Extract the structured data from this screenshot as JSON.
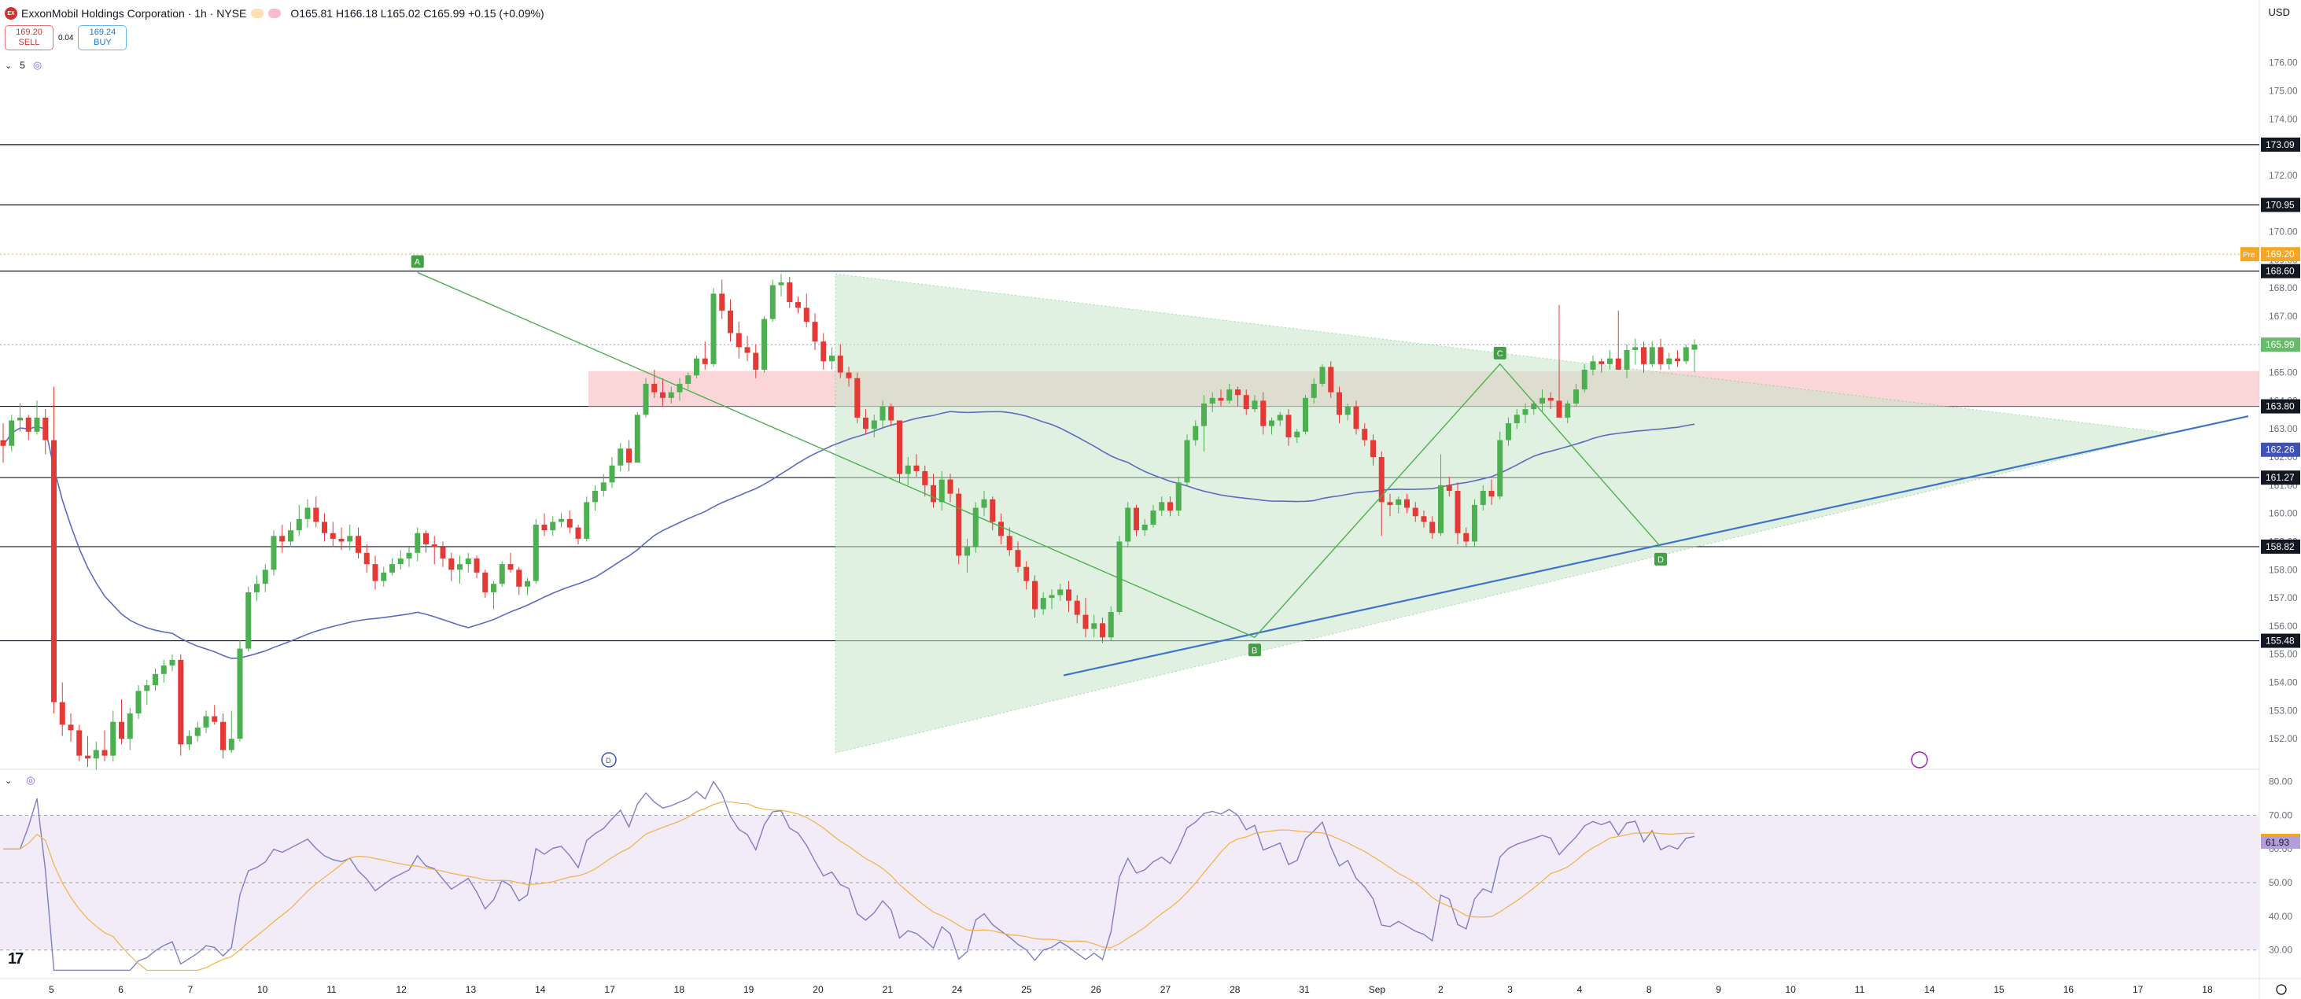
{
  "header": {
    "logo_text": "EX",
    "title": "ExxonMobil Holdings Corporation · 1h · NYSE",
    "ohlc": "O165.81 H166.18 L165.02 C165.99 +0.15 (+0.09%)"
  },
  "trade": {
    "sell_price": "169.20",
    "sell_label": "SELL",
    "spread": "0.04",
    "buy_price": "169.24",
    "buy_label": "BUY"
  },
  "indicator": {
    "count_label": "5",
    "chevron": "⌄"
  },
  "currency": "USD",
  "pre_label": "Pre",
  "tv_logo": "17",
  "colors": {
    "up": "#4caf50",
    "down": "#e53935",
    "ma": "#5c6bc0",
    "trend": "#3f74c9",
    "zone": "#f8c8cc",
    "triangle": "#c8e6c9",
    "rsi": "#7e7ec7",
    "rsi_ma": "#f5b041",
    "rsi_band": "#ede7f6"
  },
  "chart_data": {
    "type": "candlestick",
    "price_axis": {
      "range": [
        151.0,
        178.0
      ],
      "ticks": [
        "176.00",
        "175.00",
        "174.00",
        "173.00",
        "172.00",
        "171.00",
        "170.00",
        "169.00",
        "168.00",
        "167.00",
        "166.00",
        "165.00",
        "164.00",
        "163.00",
        "162.00",
        "161.00",
        "160.00",
        "159.00",
        "158.00",
        "157.00",
        "156.00",
        "155.00",
        "154.00",
        "153.00",
        "152.00"
      ],
      "labels": [
        {
          "value": 173.09,
          "text": "173.09",
          "style": "black"
        },
        {
          "value": 170.95,
          "text": "170.95",
          "style": "black"
        },
        {
          "value": 169.2,
          "text": "169.20",
          "style": "orange"
        },
        {
          "value": 168.6,
          "text": "168.60",
          "style": "black"
        },
        {
          "value": 165.99,
          "text": "165.99",
          "style": "green"
        },
        {
          "value": 163.8,
          "text": "163.80",
          "style": "black"
        },
        {
          "value": 162.26,
          "text": "162.26",
          "style": "blue"
        },
        {
          "value": 161.27,
          "text": "161.27",
          "style": "black"
        },
        {
          "value": 158.82,
          "text": "158.82",
          "style": "black"
        },
        {
          "value": 155.48,
          "text": "155.48",
          "style": "black"
        }
      ]
    },
    "horizontal_levels": [
      173.09,
      170.95,
      168.6,
      163.8,
      161.27,
      158.82,
      155.48
    ],
    "x_axis_labels": [
      "5",
      "6",
      "7",
      "10",
      "11",
      "12",
      "13",
      "14",
      "17",
      "18",
      "19",
      "20",
      "21",
      "24",
      "25",
      "26",
      "27",
      "28",
      "31",
      "Sep",
      "2",
      "3",
      "4",
      "8",
      "9",
      "10",
      "11",
      "14",
      "15",
      "16",
      "17",
      "18"
    ],
    "pattern_points": [
      {
        "label": "A",
        "bar": 49,
        "price": 168.55
      },
      {
        "label": "B",
        "bar": 148,
        "price": 155.6
      },
      {
        "label": "C",
        "bar": 177,
        "price": 165.3
      },
      {
        "label": "D",
        "bar": 196,
        "price": 158.82
      }
    ],
    "resistance_zone": [
      163.8,
      165.05
    ],
    "candles": [
      [
        162.6,
        163.2,
        161.8,
        162.4
      ],
      [
        162.4,
        163.5,
        162.2,
        163.3
      ],
      [
        163.3,
        163.9,
        162.9,
        163.4
      ],
      [
        163.4,
        163.5,
        162.6,
        162.9
      ],
      [
        162.9,
        164.0,
        162.8,
        163.4
      ],
      [
        163.4,
        163.7,
        162.1,
        162.6
      ],
      [
        162.6,
        164.5,
        152.9,
        153.3
      ],
      [
        153.3,
        154.0,
        152.1,
        152.5
      ],
      [
        152.5,
        152.9,
        151.9,
        152.3
      ],
      [
        152.3,
        152.5,
        151.2,
        151.4
      ],
      [
        151.4,
        152.1,
        151.0,
        151.3
      ],
      [
        151.3,
        151.9,
        150.9,
        151.6
      ],
      [
        151.6,
        152.3,
        151.2,
        151.4
      ],
      [
        151.4,
        153.0,
        151.2,
        152.6
      ],
      [
        152.6,
        153.4,
        151.8,
        152.0
      ],
      [
        152.0,
        153.1,
        151.6,
        152.9
      ],
      [
        152.9,
        153.9,
        152.7,
        153.7
      ],
      [
        153.7,
        154.1,
        153.2,
        153.9
      ],
      [
        153.9,
        154.5,
        153.7,
        154.3
      ],
      [
        154.3,
        154.8,
        154.0,
        154.6
      ],
      [
        154.6,
        155.0,
        154.4,
        154.8
      ],
      [
        154.8,
        155.0,
        151.4,
        151.8
      ],
      [
        151.8,
        152.3,
        151.6,
        152.1
      ],
      [
        152.1,
        152.6,
        151.9,
        152.4
      ],
      [
        152.4,
        153.0,
        152.2,
        152.8
      ],
      [
        152.8,
        153.2,
        152.5,
        152.6
      ],
      [
        152.6,
        152.9,
        151.3,
        151.6
      ],
      [
        151.6,
        153.0,
        151.5,
        152.0
      ],
      [
        152.0,
        155.5,
        151.9,
        155.2
      ],
      [
        155.2,
        157.4,
        155.1,
        157.2
      ],
      [
        157.2,
        157.8,
        156.9,
        157.5
      ],
      [
        157.5,
        158.2,
        157.2,
        158.0
      ],
      [
        158.0,
        159.4,
        157.8,
        159.2
      ],
      [
        159.2,
        159.6,
        158.6,
        159.0
      ],
      [
        159.0,
        159.7,
        158.8,
        159.4
      ],
      [
        159.4,
        160.3,
        159.2,
        159.8
      ],
      [
        159.8,
        160.5,
        159.5,
        160.2
      ],
      [
        160.2,
        160.6,
        159.5,
        159.7
      ],
      [
        159.7,
        160.0,
        159.0,
        159.3
      ],
      [
        159.3,
        159.7,
        158.8,
        159.1
      ],
      [
        159.1,
        159.5,
        158.7,
        159.0
      ],
      [
        159.0,
        159.6,
        158.7,
        159.2
      ],
      [
        159.2,
        159.5,
        158.4,
        158.6
      ],
      [
        158.6,
        158.9,
        157.9,
        158.2
      ],
      [
        158.2,
        158.5,
        157.3,
        157.6
      ],
      [
        157.6,
        158.1,
        157.4,
        157.9
      ],
      [
        157.9,
        158.4,
        157.8,
        158.2
      ],
      [
        158.2,
        158.7,
        158.0,
        158.4
      ],
      [
        158.4,
        158.8,
        158.1,
        158.6
      ],
      [
        158.6,
        159.5,
        158.3,
        159.3
      ],
      [
        159.3,
        159.4,
        158.6,
        158.9
      ],
      [
        158.9,
        159.2,
        158.2,
        158.8
      ],
      [
        158.8,
        159.0,
        158.1,
        158.4
      ],
      [
        158.4,
        158.6,
        157.6,
        158.0
      ],
      [
        158.0,
        158.5,
        157.5,
        158.2
      ],
      [
        158.2,
        158.6,
        157.9,
        158.4
      ],
      [
        158.4,
        158.5,
        157.7,
        157.9
      ],
      [
        157.9,
        158.0,
        157.0,
        157.2
      ],
      [
        157.2,
        157.6,
        156.6,
        157.5
      ],
      [
        157.5,
        158.3,
        157.4,
        158.2
      ],
      [
        158.2,
        158.6,
        157.9,
        158.0
      ],
      [
        158.0,
        158.1,
        157.1,
        157.4
      ],
      [
        157.4,
        157.7,
        157.1,
        157.6
      ],
      [
        157.6,
        159.8,
        157.5,
        159.6
      ],
      [
        159.6,
        160.0,
        159.2,
        159.4
      ],
      [
        159.4,
        159.9,
        159.2,
        159.7
      ],
      [
        159.7,
        160.0,
        159.5,
        159.8
      ],
      [
        159.8,
        160.1,
        159.3,
        159.5
      ],
      [
        159.5,
        159.6,
        158.9,
        159.1
      ],
      [
        159.1,
        160.6,
        159.0,
        160.4
      ],
      [
        160.4,
        161.0,
        160.1,
        160.8
      ],
      [
        160.8,
        161.4,
        160.6,
        161.1
      ],
      [
        161.1,
        162.0,
        160.9,
        161.7
      ],
      [
        161.7,
        162.5,
        161.5,
        162.3
      ],
      [
        162.3,
        162.6,
        161.5,
        161.8
      ],
      [
        161.8,
        163.6,
        163.2,
        163.5
      ],
      [
        163.5,
        164.8,
        163.4,
        164.6
      ],
      [
        164.6,
        165.1,
        164.1,
        164.3
      ],
      [
        164.3,
        164.8,
        163.8,
        164.1
      ],
      [
        164.1,
        164.5,
        163.9,
        164.3
      ],
      [
        164.3,
        164.8,
        164.0,
        164.6
      ],
      [
        164.6,
        165.0,
        164.4,
        164.9
      ],
      [
        164.9,
        165.6,
        164.8,
        165.5
      ],
      [
        165.5,
        166.1,
        165.1,
        165.3
      ],
      [
        165.3,
        168.0,
        165.2,
        167.8
      ],
      [
        167.8,
        168.3,
        166.9,
        167.2
      ],
      [
        167.2,
        167.6,
        166.1,
        166.4
      ],
      [
        166.4,
        166.8,
        165.5,
        165.9
      ],
      [
        165.9,
        166.3,
        165.4,
        165.7
      ],
      [
        165.7,
        166.0,
        164.8,
        165.1
      ],
      [
        165.1,
        167.0,
        165.0,
        166.9
      ],
      [
        166.9,
        168.3,
        166.8,
        168.1
      ],
      [
        168.1,
        168.5,
        167.7,
        168.2
      ],
      [
        168.2,
        168.4,
        167.3,
        167.5
      ],
      [
        167.5,
        167.7,
        167.1,
        167.3
      ],
      [
        167.3,
        167.8,
        166.6,
        166.8
      ],
      [
        166.8,
        167.1,
        165.8,
        166.1
      ],
      [
        166.1,
        166.4,
        165.1,
        165.4
      ],
      [
        165.4,
        165.9,
        165.1,
        165.6
      ],
      [
        165.6,
        166.0,
        164.8,
        165.0
      ],
      [
        165.0,
        165.2,
        164.5,
        164.8
      ],
      [
        164.8,
        165.0,
        163.2,
        163.4
      ],
      [
        163.4,
        163.7,
        162.8,
        163.0
      ],
      [
        163.0,
        163.5,
        162.7,
        163.3
      ],
      [
        163.3,
        164.0,
        163.0,
        163.8
      ],
      [
        163.8,
        163.9,
        163.1,
        163.3
      ],
      [
        163.3,
        162.6,
        161.1,
        161.4
      ],
      [
        161.4,
        162.0,
        161.0,
        161.7
      ],
      [
        161.7,
        162.1,
        161.3,
        161.5
      ],
      [
        161.5,
        161.7,
        160.6,
        161.0
      ],
      [
        161.0,
        161.4,
        160.2,
        160.4
      ],
      [
        160.4,
        161.5,
        160.1,
        161.2
      ],
      [
        161.2,
        161.4,
        160.4,
        160.7
      ],
      [
        160.7,
        160.9,
        158.2,
        158.5
      ],
      [
        158.5,
        159.1,
        157.9,
        158.8
      ],
      [
        158.8,
        160.4,
        158.6,
        160.2
      ],
      [
        160.2,
        160.8,
        159.9,
        160.5
      ],
      [
        160.5,
        160.6,
        159.4,
        159.7
      ],
      [
        159.7,
        160.0,
        158.9,
        159.2
      ],
      [
        159.2,
        159.5,
        158.5,
        158.7
      ],
      [
        158.7,
        159.0,
        157.9,
        158.1
      ],
      [
        158.1,
        158.3,
        157.3,
        157.6
      ],
      [
        157.6,
        157.8,
        156.3,
        156.6
      ],
      [
        156.6,
        157.2,
        156.4,
        157.0
      ],
      [
        157.0,
        157.3,
        156.6,
        157.1
      ],
      [
        157.1,
        157.5,
        156.9,
        157.3
      ],
      [
        157.3,
        157.6,
        156.5,
        156.9
      ],
      [
        156.9,
        157.1,
        156.1,
        156.4
      ],
      [
        156.4,
        157.0,
        155.6,
        155.9
      ],
      [
        155.9,
        156.4,
        155.6,
        156.1
      ],
      [
        156.1,
        156.3,
        155.4,
        155.6
      ],
      [
        155.6,
        156.7,
        155.5,
        156.5
      ],
      [
        156.5,
        159.2,
        156.4,
        159.0
      ],
      [
        159.0,
        160.4,
        158.8,
        160.2
      ],
      [
        160.2,
        160.3,
        159.2,
        159.4
      ],
      [
        159.4,
        159.8,
        159.2,
        159.6
      ],
      [
        159.6,
        160.3,
        159.5,
        160.1
      ],
      [
        160.1,
        160.6,
        159.9,
        160.4
      ],
      [
        160.4,
        160.6,
        159.9,
        160.1
      ],
      [
        160.1,
        161.3,
        159.9,
        161.1
      ],
      [
        161.1,
        162.8,
        161.0,
        162.6
      ],
      [
        162.6,
        163.3,
        162.4,
        163.1
      ],
      [
        163.1,
        164.2,
        162.2,
        163.9
      ],
      [
        163.9,
        164.3,
        163.6,
        164.1
      ],
      [
        164.1,
        164.4,
        163.8,
        164.0
      ],
      [
        164.0,
        164.6,
        163.9,
        164.4
      ],
      [
        164.4,
        164.5,
        163.8,
        164.2
      ],
      [
        164.2,
        164.4,
        163.5,
        163.7
      ],
      [
        163.7,
        164.2,
        163.6,
        164.0
      ],
      [
        164.0,
        164.3,
        162.8,
        163.1
      ],
      [
        163.1,
        163.4,
        162.8,
        163.3
      ],
      [
        163.3,
        163.6,
        163.1,
        163.5
      ],
      [
        163.5,
        163.7,
        162.4,
        162.7
      ],
      [
        162.7,
        163.0,
        162.5,
        162.9
      ],
      [
        162.9,
        164.2,
        162.8,
        164.1
      ],
      [
        164.1,
        164.8,
        163.9,
        164.6
      ],
      [
        164.6,
        165.3,
        164.5,
        165.2
      ],
      [
        165.2,
        165.4,
        164.1,
        164.3
      ],
      [
        164.3,
        164.5,
        163.2,
        163.5
      ],
      [
        163.5,
        163.9,
        163.3,
        163.8
      ],
      [
        163.8,
        164.0,
        162.8,
        163.0
      ],
      [
        163.0,
        163.2,
        162.4,
        162.6
      ],
      [
        162.6,
        162.8,
        161.7,
        162.0
      ],
      [
        162.0,
        162.2,
        159.2,
        160.4
      ],
      [
        160.4,
        160.7,
        159.9,
        160.3
      ],
      [
        160.3,
        160.6,
        160.0,
        160.5
      ],
      [
        160.5,
        160.7,
        160.0,
        160.2
      ],
      [
        160.2,
        160.4,
        159.7,
        159.9
      ],
      [
        159.9,
        160.1,
        159.5,
        159.7
      ],
      [
        159.7,
        159.9,
        159.1,
        159.3
      ],
      [
        159.3,
        162.1,
        159.2,
        161.0
      ],
      [
        161.0,
        161.3,
        160.6,
        160.8
      ],
      [
        160.8,
        161.1,
        158.9,
        159.3
      ],
      [
        159.3,
        159.5,
        158.8,
        159.0
      ],
      [
        159.0,
        160.5,
        158.8,
        160.3
      ],
      [
        160.3,
        161.0,
        160.1,
        160.8
      ],
      [
        160.8,
        161.2,
        160.3,
        160.6
      ],
      [
        160.6,
        162.9,
        160.5,
        162.6
      ],
      [
        162.6,
        163.4,
        162.4,
        163.2
      ],
      [
        163.2,
        163.7,
        163.0,
        163.5
      ],
      [
        163.5,
        163.9,
        163.2,
        163.7
      ],
      [
        163.7,
        164.0,
        163.5,
        163.9
      ],
      [
        163.9,
        164.4,
        163.6,
        164.1
      ],
      [
        164.1,
        164.3,
        163.7,
        164.0
      ],
      [
        164.0,
        167.4,
        163.8,
        163.4
      ],
      [
        163.4,
        164.0,
        163.2,
        163.9
      ],
      [
        163.9,
        164.6,
        163.8,
        164.4
      ],
      [
        164.4,
        165.3,
        164.3,
        165.1
      ],
      [
        165.1,
        165.6,
        164.9,
        165.4
      ],
      [
        165.4,
        165.5,
        165.0,
        165.3
      ],
      [
        165.3,
        165.8,
        165.1,
        165.5
      ],
      [
        165.5,
        167.2,
        165.3,
        165.1
      ],
      [
        165.1,
        166.0,
        164.8,
        165.8
      ],
      [
        165.8,
        166.2,
        165.3,
        165.9
      ],
      [
        165.9,
        166.1,
        165.0,
        165.3
      ],
      [
        165.3,
        166.1,
        165.2,
        165.9
      ],
      [
        165.9,
        166.2,
        165.1,
        165.3
      ],
      [
        165.3,
        165.7,
        165.1,
        165.5
      ],
      [
        165.5,
        165.8,
        165.2,
        165.4
      ],
      [
        165.4,
        166.0,
        165.3,
        165.9
      ],
      [
        165.81,
        166.18,
        165.02,
        165.99
      ]
    ],
    "rsi": {
      "axis_ticks": [
        "80.00",
        "70.00",
        "60.00",
        "50.00",
        "40.00",
        "30.00"
      ],
      "range": [
        22,
        82
      ],
      "bands": [
        70,
        50,
        30
      ],
      "last_labels": [
        {
          "value": 62.64,
          "text": "62.64",
          "style": "orange"
        },
        {
          "value": 61.93,
          "text": "61.93",
          "style": "purple"
        }
      ]
    }
  }
}
